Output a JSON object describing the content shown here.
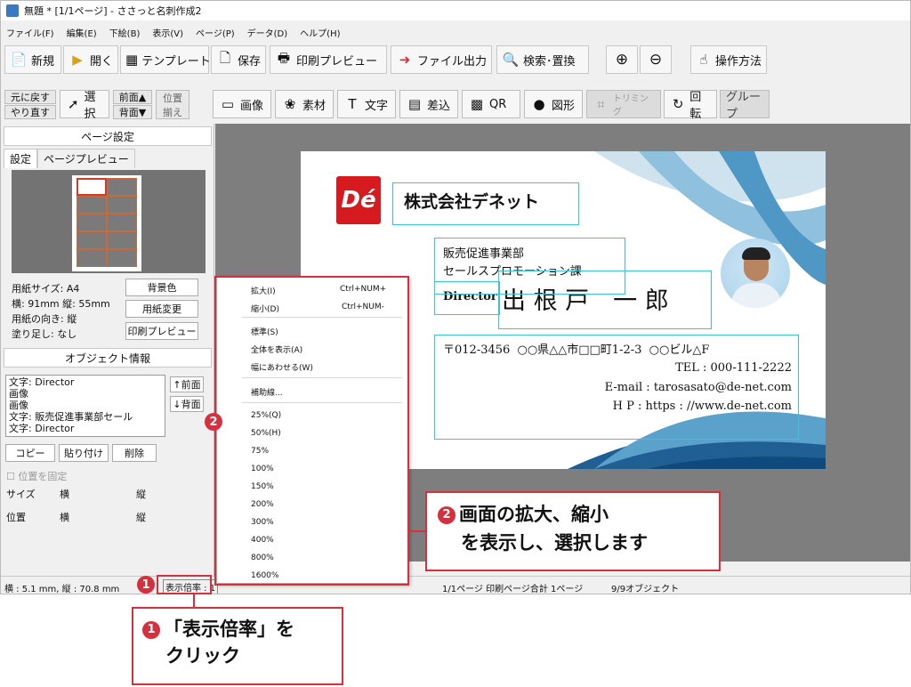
{
  "window": {
    "title": "無題 * [1/1ページ] - ささっと名刺作成2"
  },
  "menubar": [
    "ファイル(F)",
    "編集(E)",
    "下絵(B)",
    "表示(V)",
    "ページ(P)",
    "データ(D)",
    "ヘルプ(H)"
  ],
  "toolbar": {
    "new": "新規",
    "open": "開く",
    "template": "テンプレート",
    "save": "保存",
    "print_preview": "印刷プレビュー",
    "file_output": "ファイル出力",
    "search_replace": "検索･置換",
    "help": "操作方法"
  },
  "toolbar2": {
    "undo": "元に戻す",
    "redo": "やり直す",
    "select": "選択",
    "front": "前面▲",
    "back": "背面▼",
    "align_1": "位置",
    "align_2": "揃え",
    "image": "画像",
    "material": "素材",
    "text": "文字",
    "merge": "差込",
    "qr": "QR",
    "shape": "図形",
    "trim": "トリミング",
    "rotate": "回転",
    "group": "グループ"
  },
  "page_settings": {
    "header": "ページ設定",
    "tab_settings": "設定",
    "tab_preview": "ページプレビュー",
    "paper_size": "用紙サイズ: A4",
    "dimensions": "横: 91mm  縦: 55mm",
    "orientation": "用紙の向き: 縦",
    "bleed": "塗り足し: なし",
    "bg_color": "背景色",
    "change_paper": "用紙変更",
    "print_preview": "印刷プレビュー"
  },
  "object_info": {
    "header": "オブジェクト情報",
    "items": [
      "文字: Director",
      "画像",
      "画像",
      "文字: 販売促進事業部セール",
      "文字: Director"
    ],
    "front": "↑前面",
    "back": "↓背面",
    "copy": "コピー",
    "paste": "貼り付け",
    "delete": "削除",
    "lock_position": "位置を固定",
    "size": "サイズ",
    "horizontal": "横",
    "vertical": "縦",
    "position": "位置"
  },
  "card": {
    "logo": "Dé",
    "company": "株式会社デネット",
    "dept1": "販売促進事業部",
    "dept2": "セールスプロモーション課",
    "title": "Director",
    "name": "出 根 戸　一 郎",
    "address": "〒012-3456  ○○県△△市□□町1-2-3  ○○ビル△F",
    "tel": "TEL : 000-111-2222",
    "email": "E-mail : tarosasato@de-net.com",
    "hp": "H P : https : //www.de-net.com"
  },
  "context_menu": {
    "zoom_in": "拡大(I)",
    "zoom_in_key": "Ctrl+NUM+",
    "zoom_out": "縮小(D)",
    "zoom_out_key": "Ctrl+NUM-",
    "standard": "標準(S)",
    "show_all": "全体を表示(A)",
    "fit_width": "幅にあわせる(W)",
    "guides": "補助線...",
    "levels": [
      "25%(Q)",
      "50%(H)",
      "75%",
      "100%",
      "150%",
      "200%",
      "300%",
      "400%",
      "800%",
      "1600%"
    ]
  },
  "statusbar": {
    "coords": "横 : 5.1 mm, 縦 : 70.8 mm",
    "zoom": "表示倍率 : 1",
    "pages": "1/1ページ 印刷ページ合計 1ページ",
    "objects": "9/9オブジェクト"
  },
  "callouts": {
    "one_num": "1",
    "one_line1": "「表示倍率」を",
    "one_line2": "クリック",
    "two_num": "2",
    "two_line1": "画面の拡大、縮小",
    "two_line2": "を表示し、選択します"
  },
  "colors": {
    "accent_red": "#d5303e",
    "selection": "#3cc3d6",
    "logo_red": "#d61a1f"
  }
}
